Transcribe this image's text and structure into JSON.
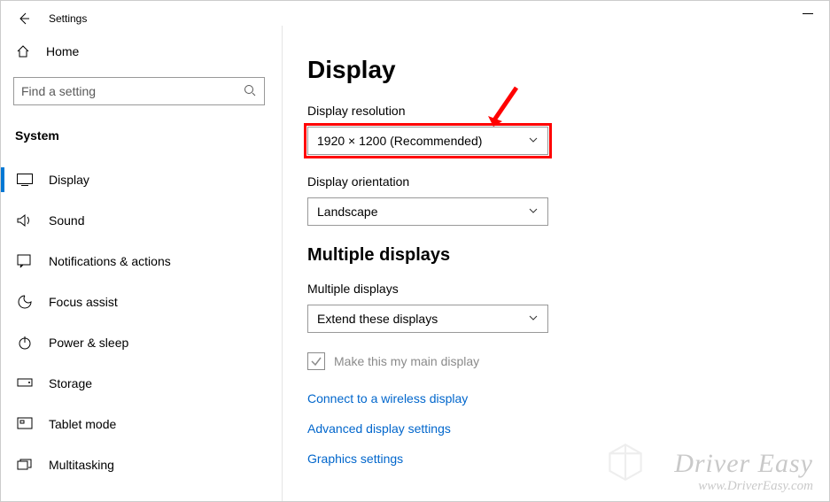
{
  "titlebar": {
    "title": "Settings"
  },
  "sidebar": {
    "home_label": "Home",
    "search_placeholder": "Find a setting",
    "section_label": "System",
    "items": [
      {
        "label": "Display"
      },
      {
        "label": "Sound"
      },
      {
        "label": "Notifications & actions"
      },
      {
        "label": "Focus assist"
      },
      {
        "label": "Power & sleep"
      },
      {
        "label": "Storage"
      },
      {
        "label": "Tablet mode"
      },
      {
        "label": "Multitasking"
      }
    ]
  },
  "content": {
    "page_title": "Display",
    "resolution_label": "Display resolution",
    "resolution_value": "1920 × 1200 (Recommended)",
    "orientation_label": "Display orientation",
    "orientation_value": "Landscape",
    "multiple_heading": "Multiple displays",
    "multiple_label": "Multiple displays",
    "multiple_value": "Extend these displays",
    "main_display_checkbox": "Make this my main display",
    "links": [
      "Connect to a wireless display",
      "Advanced display settings",
      "Graphics settings"
    ]
  },
  "watermark": {
    "brand": "Driver Easy",
    "url": "www.DriverEasy.com"
  }
}
